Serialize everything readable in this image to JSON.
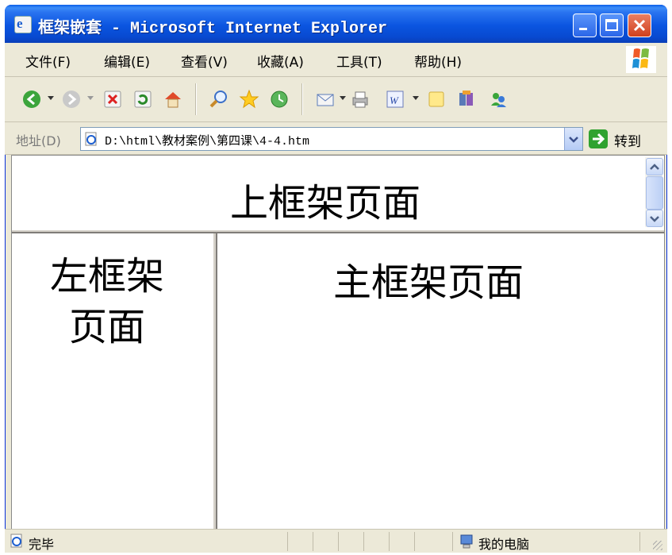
{
  "window": {
    "title": "框架嵌套 - Microsoft Internet Explorer"
  },
  "menu": {
    "items": [
      {
        "label": "文件(F)"
      },
      {
        "label": "编辑(E)"
      },
      {
        "label": "查看(V)"
      },
      {
        "label": "收藏(A)"
      },
      {
        "label": "工具(T)"
      },
      {
        "label": "帮助(H)"
      }
    ]
  },
  "toolbar": {
    "icons": [
      "back-icon",
      "forward-icon",
      "stop-icon",
      "refresh-icon",
      "home-icon",
      "search-icon",
      "favorites-icon",
      "history-icon",
      "mail-icon",
      "print-icon",
      "edit-icon",
      "discuss-icon",
      "research-icon",
      "messenger-icon"
    ]
  },
  "address": {
    "label": "地址(D)",
    "value": "D:\\html\\教材案例\\第四课\\4-4.htm",
    "go_label": "转到"
  },
  "frames": {
    "top_text": "上框架页面",
    "left_line1": "左框架",
    "left_line2": "页面",
    "main_text": "主框架页面"
  },
  "status": {
    "text": "完毕",
    "zone": "我的电脑"
  },
  "colors": {
    "titlebar": "#0a55e0",
    "chrome": "#ece9d8",
    "go_green": "#2fa22f",
    "close_red": "#d0401d"
  }
}
